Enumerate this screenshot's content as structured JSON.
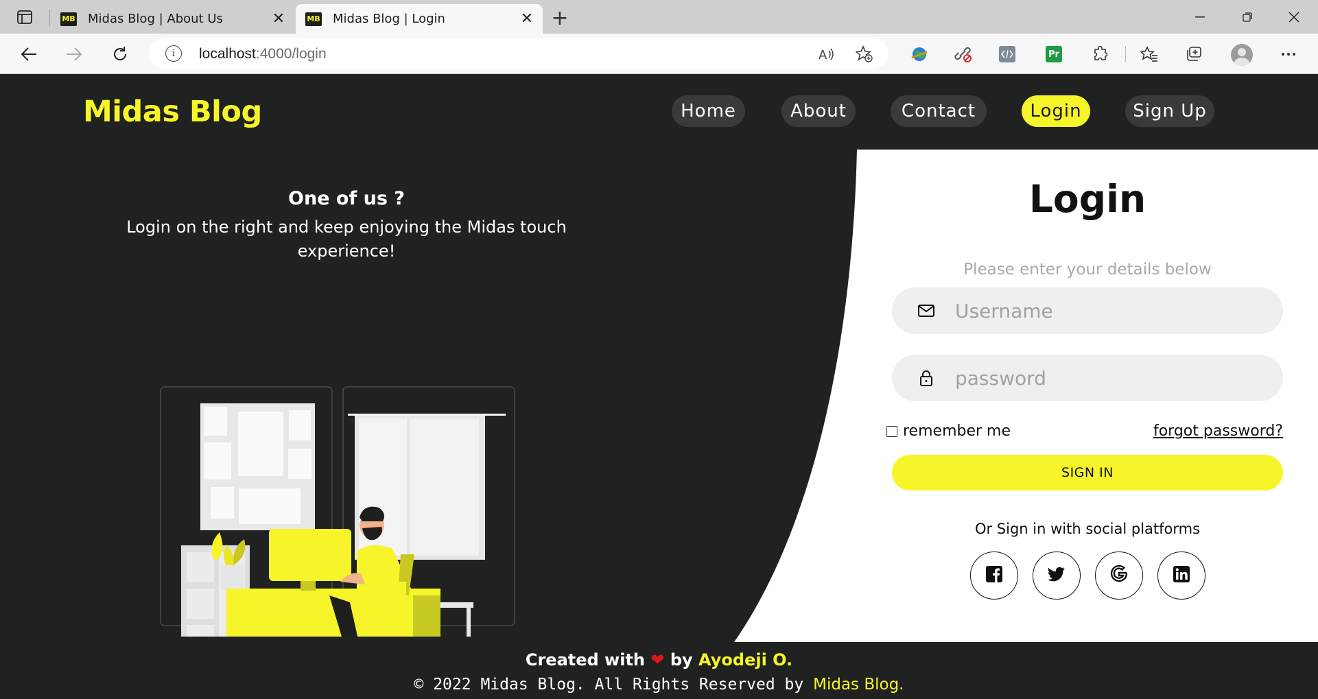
{
  "browser": {
    "tabs": [
      {
        "favicon": "MB",
        "title": "Midas Blog | About Us",
        "active": false
      },
      {
        "favicon": "MB",
        "title": "Midas Blog | Login",
        "active": true
      }
    ],
    "url_host": "localhost",
    "url_path": ":4000/login",
    "icons": {
      "sidebar": "tab-actions-icon",
      "new_tab": "plus-icon",
      "minimize": "minimize-icon",
      "restore": "restore-icon",
      "close": "close-icon",
      "back": "back-arrow-icon",
      "forward": "forward-arrow-icon",
      "refresh": "refresh-icon",
      "site_info": "info-icon",
      "read_aloud": "read-aloud-icon",
      "favorite": "add-favorite-icon",
      "extensions": "extensions-icon",
      "favorites": "favorites-icon",
      "collections": "collections-icon",
      "more": "more-icon"
    }
  },
  "site": {
    "logo": "Midas Blog",
    "nav": [
      {
        "label": "Home",
        "active": false
      },
      {
        "label": "About",
        "active": false
      },
      {
        "label": "Contact",
        "active": false
      },
      {
        "label": "Login",
        "active": true
      },
      {
        "label": "Sign Up",
        "active": false
      }
    ],
    "hero": {
      "title": "One of us ?",
      "subtitle": "Login on the right and keep enjoying the Midas touch experience!"
    }
  },
  "login": {
    "title": "Login",
    "subtitle": "Please enter your details below",
    "username_placeholder": "Username",
    "password_placeholder": "password",
    "remember_label": "remember me",
    "forgot_label": "forgot password?",
    "signin_label": "SIGN IN",
    "social_text": "Or Sign in with social platforms",
    "social": [
      "facebook-icon",
      "twitter-icon",
      "google-icon",
      "linkedin-icon"
    ]
  },
  "footer": {
    "created_prefix": "Created with",
    "heart": "❤",
    "by": "by",
    "author": "Ayodeji O.",
    "copyright": "© 2022 Midas Blog. All Rights Reserved by",
    "brand": "Midas Blog."
  },
  "colors": {
    "accent": "#f5f52a",
    "background": "#202121",
    "panel": "#ffffff",
    "nav_pill": "#3a3a3a",
    "heart": "#e0161a"
  }
}
